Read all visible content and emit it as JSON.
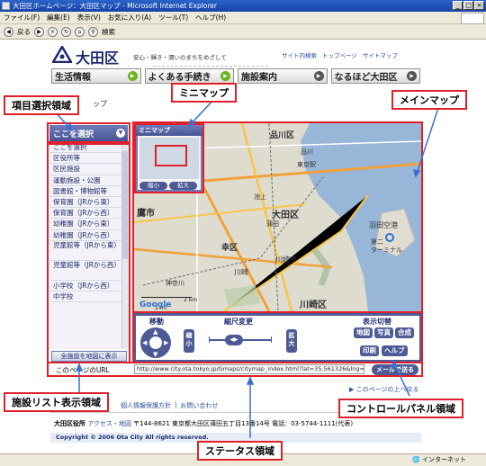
{
  "window": {
    "title": "大田区ホームページ：大田区マップ - Microsoft Internet Explorer",
    "controls": [
      "_",
      "□",
      "×"
    ],
    "menu": [
      "ファイル(F)",
      "編集(E)",
      "表示(V)",
      "お気に入り(A)",
      "ツール(T)",
      "ヘルプ(H)"
    ],
    "toolbar": {
      "back": "戻る",
      "search": "検索"
    }
  },
  "header": {
    "site_name": "大田区",
    "tagline": "安心・輝き・潤いのまちをめざして",
    "links": [
      "サイト内検索",
      "トップページ",
      "サイトマップ"
    ],
    "nav": [
      {
        "label": "生活情報",
        "arrow": "green"
      },
      {
        "label": "よくある手続き",
        "arrow": "green"
      },
      {
        "label": "施設案内",
        "arrow": "dark"
      },
      {
        "label": "なるほど大田区",
        "arrow": "dark"
      }
    ],
    "breadcrumb": "ップ"
  },
  "left_panel": {
    "header": "ここを選択",
    "items": [
      {
        "label": "ここを選択"
      },
      {
        "label": "区役所等"
      },
      {
        "label": "区民施設"
      },
      {
        "label": "運動施設・公園"
      },
      {
        "label": "図書館・博物館等"
      },
      {
        "label": "保育園（JRから東）"
      },
      {
        "label": "保育園（JRから西）"
      },
      {
        "label": "幼稚園（JRから東）"
      },
      {
        "label": "幼稚園（JRから西）"
      },
      {
        "label": "児童館等（JRから東）",
        "tall": true
      },
      {
        "label": "児童館等（JRから西）",
        "tall": true
      },
      {
        "label": "小学校（JRから西）"
      },
      {
        "label": "中学校"
      }
    ],
    "show_all_button": "全施設を地図に表示"
  },
  "mini_map": {
    "header": "ミニマップ",
    "shrink": "縮小",
    "enlarge": "拡大"
  },
  "main_map": {
    "labels": {
      "shinagawa": "品川区",
      "ota": "大田区",
      "mitaka": "鷹市",
      "saiwai": "幸区",
      "kawasaki": "川崎区",
      "kawasaki_sta": "川崎",
      "kawasaki_city": "川崎市",
      "haneda": "羽田空港",
      "terminal": "ターミナル",
      "tokyo_sta": "東京駅",
      "second": "第二",
      "shinagawa_sta": "品川",
      "kamata": "蒲田",
      "ikegami": "池上",
      "higashi_kanagawa": "神奈川",
      "scale_km": "2 km",
      "scale_mi": "1 mi",
      "google": "Google"
    }
  },
  "control_panel": {
    "move_label": "移動",
    "scale_label": "縮尺変更",
    "shrink": "縮小",
    "enlarge": "拡大",
    "switch_label": "表示切替",
    "map": "地図",
    "photo": "写真",
    "composite": "合成",
    "print": "印刷",
    "help": "ヘルプ"
  },
  "url_row": {
    "label": "このページのURL",
    "value": "http://www.city.ota.tokyo.jp/Gmaps/citymap_index.html?lat=35.561326&lng=13",
    "mail_button": "メールで送る"
  },
  "to_top": "このページの上へ戻る",
  "footer": {
    "links": [
      "個人情報保護方針",
      "お問い合わせ"
    ],
    "office": "大田区役所",
    "access": "アクセス・地図",
    "address": "〒144-8621 東京都大田区蒲田五丁目13番14号 電話：03-5744-1111(代表)",
    "copyright": "Copyright © 2006 Ota City All rights reserved."
  },
  "status_bar": {
    "zone": "インターネット"
  },
  "annotations": {
    "item_select": "項目選択領域",
    "mini_map": "ミニマップ",
    "main_map": "メインマップ",
    "facility_list": "施設リスト表示領域",
    "control_panel": "コントロールパネル領域",
    "status": "ステータス領域"
  },
  "colors": {
    "accent": "#4d5a95",
    "annotation": "#e0202a",
    "nav_green": "#69b51d"
  }
}
